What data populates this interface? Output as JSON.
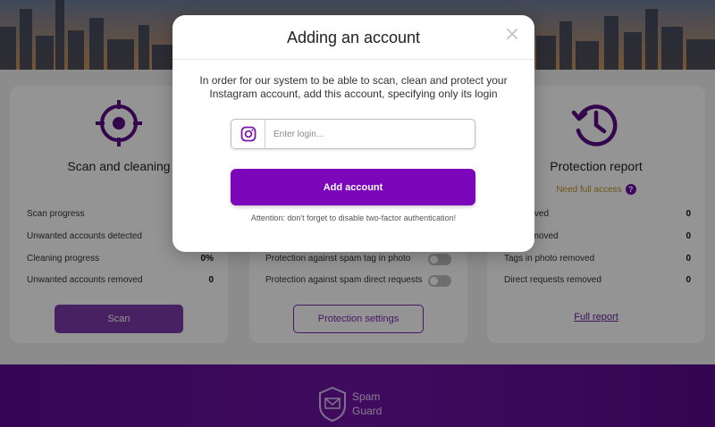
{
  "cards": {
    "scan": {
      "title": "Scan and cleaning",
      "rows": [
        {
          "label": "Scan progress",
          "value": ""
        },
        {
          "label": "Unwanted accounts detected",
          "value": ""
        },
        {
          "label": "Cleaning progress",
          "value": "0%"
        },
        {
          "label": "Unwanted accounts removed",
          "value": "0"
        }
      ],
      "button": "Scan"
    },
    "protection": {
      "rows": [
        {
          "label": "Protection against spam tag in photo"
        },
        {
          "label": "Protection against spam direct requests"
        }
      ],
      "button": "Protection settings"
    },
    "report": {
      "title": "Protection report",
      "subtitle": "Need full access",
      "rows": [
        {
          "label": "rs removed",
          "value": "0"
        },
        {
          "label": "unts removed",
          "value": "0"
        },
        {
          "label": "Tags in photo removed",
          "value": "0"
        },
        {
          "label": "Direct requests removed",
          "value": "0"
        }
      ],
      "link": "Full report"
    }
  },
  "footer": {
    "logo_line1": "Spam",
    "logo_line2": "Guard"
  },
  "modal": {
    "title": "Adding an account",
    "description": "In order for our system to be able to scan, clean and protect your Instagram account, add this account, specifying only its login",
    "login_placeholder": "Enter login...",
    "login_value": "",
    "add_button": "Add account",
    "attention": "Attention: don't forget to disable two-factor authentication!"
  },
  "colors": {
    "accent": "#7c06b9",
    "footer": "#6e13a4",
    "warning": "#c7922c"
  }
}
